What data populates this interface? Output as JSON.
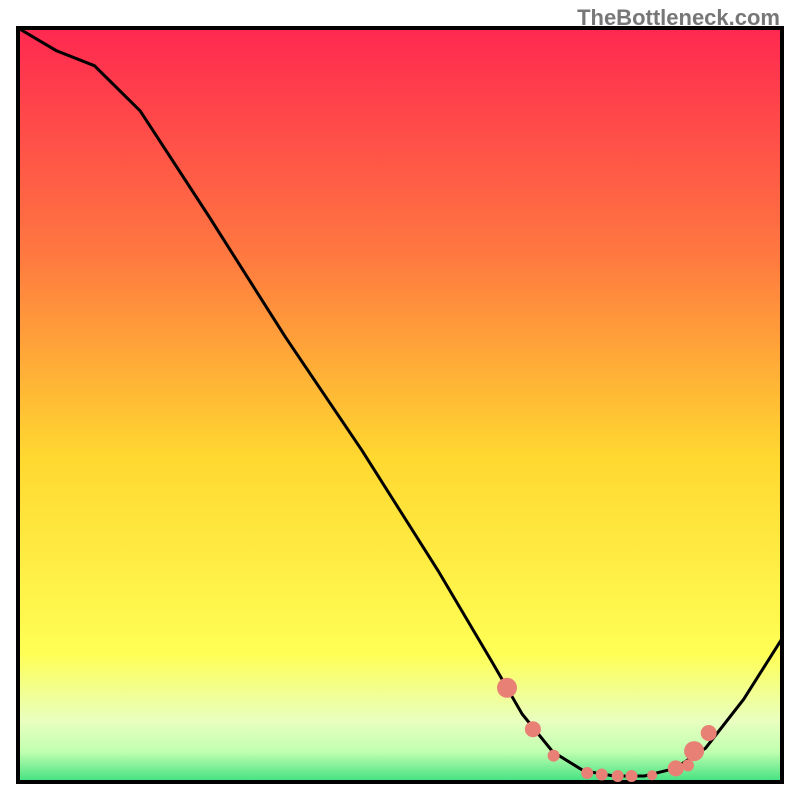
{
  "attribution": "TheBottleneck.com",
  "chart_data": {
    "type": "line",
    "title": "",
    "xlabel": "",
    "ylabel": "",
    "xlim": [
      0,
      100
    ],
    "ylim": [
      0,
      100
    ],
    "gradient_background": {
      "top": "#ff2850",
      "upper_mid": "#ff7840",
      "mid": "#ffd830",
      "lower_mid": "#ffff55",
      "low1": "#e8ffc0",
      "low2": "#c0ffb0",
      "bottom": "#40e080"
    },
    "curve": [
      {
        "x": 0,
        "y": 100
      },
      {
        "x": 5,
        "y": 97
      },
      {
        "x": 10,
        "y": 95
      },
      {
        "x": 16,
        "y": 89
      },
      {
        "x": 25,
        "y": 75
      },
      {
        "x": 35,
        "y": 59
      },
      {
        "x": 45,
        "y": 44
      },
      {
        "x": 55,
        "y": 28
      },
      {
        "x": 62,
        "y": 16
      },
      {
        "x": 66,
        "y": 9
      },
      {
        "x": 70,
        "y": 4
      },
      {
        "x": 74,
        "y": 1.5
      },
      {
        "x": 78,
        "y": 0.8
      },
      {
        "x": 82,
        "y": 0.8
      },
      {
        "x": 86,
        "y": 1.8
      },
      {
        "x": 90,
        "y": 4.5
      },
      {
        "x": 95,
        "y": 11
      },
      {
        "x": 100,
        "y": 19
      }
    ],
    "markers": [
      {
        "x": 64,
        "y": 12.5,
        "size": 10
      },
      {
        "x": 67.4,
        "y": 7,
        "size": 8
      },
      {
        "x": 70.1,
        "y": 3.5,
        "size": 6
      },
      {
        "x": 74.5,
        "y": 1.2,
        "size": 6
      },
      {
        "x": 76.4,
        "y": 1.0,
        "size": 6
      },
      {
        "x": 78.5,
        "y": 0.8,
        "size": 6
      },
      {
        "x": 80.3,
        "y": 0.8,
        "size": 6
      },
      {
        "x": 83,
        "y": 0.9,
        "size": 5
      },
      {
        "x": 86.1,
        "y": 1.8,
        "size": 8
      },
      {
        "x": 87.7,
        "y": 2.2,
        "size": 6
      },
      {
        "x": 88.5,
        "y": 4.1,
        "size": 10
      },
      {
        "x": 90.4,
        "y": 6.5,
        "size": 8
      }
    ],
    "marker_color": "#e88076",
    "curve_color": "#000000",
    "border_color": "#000000"
  }
}
